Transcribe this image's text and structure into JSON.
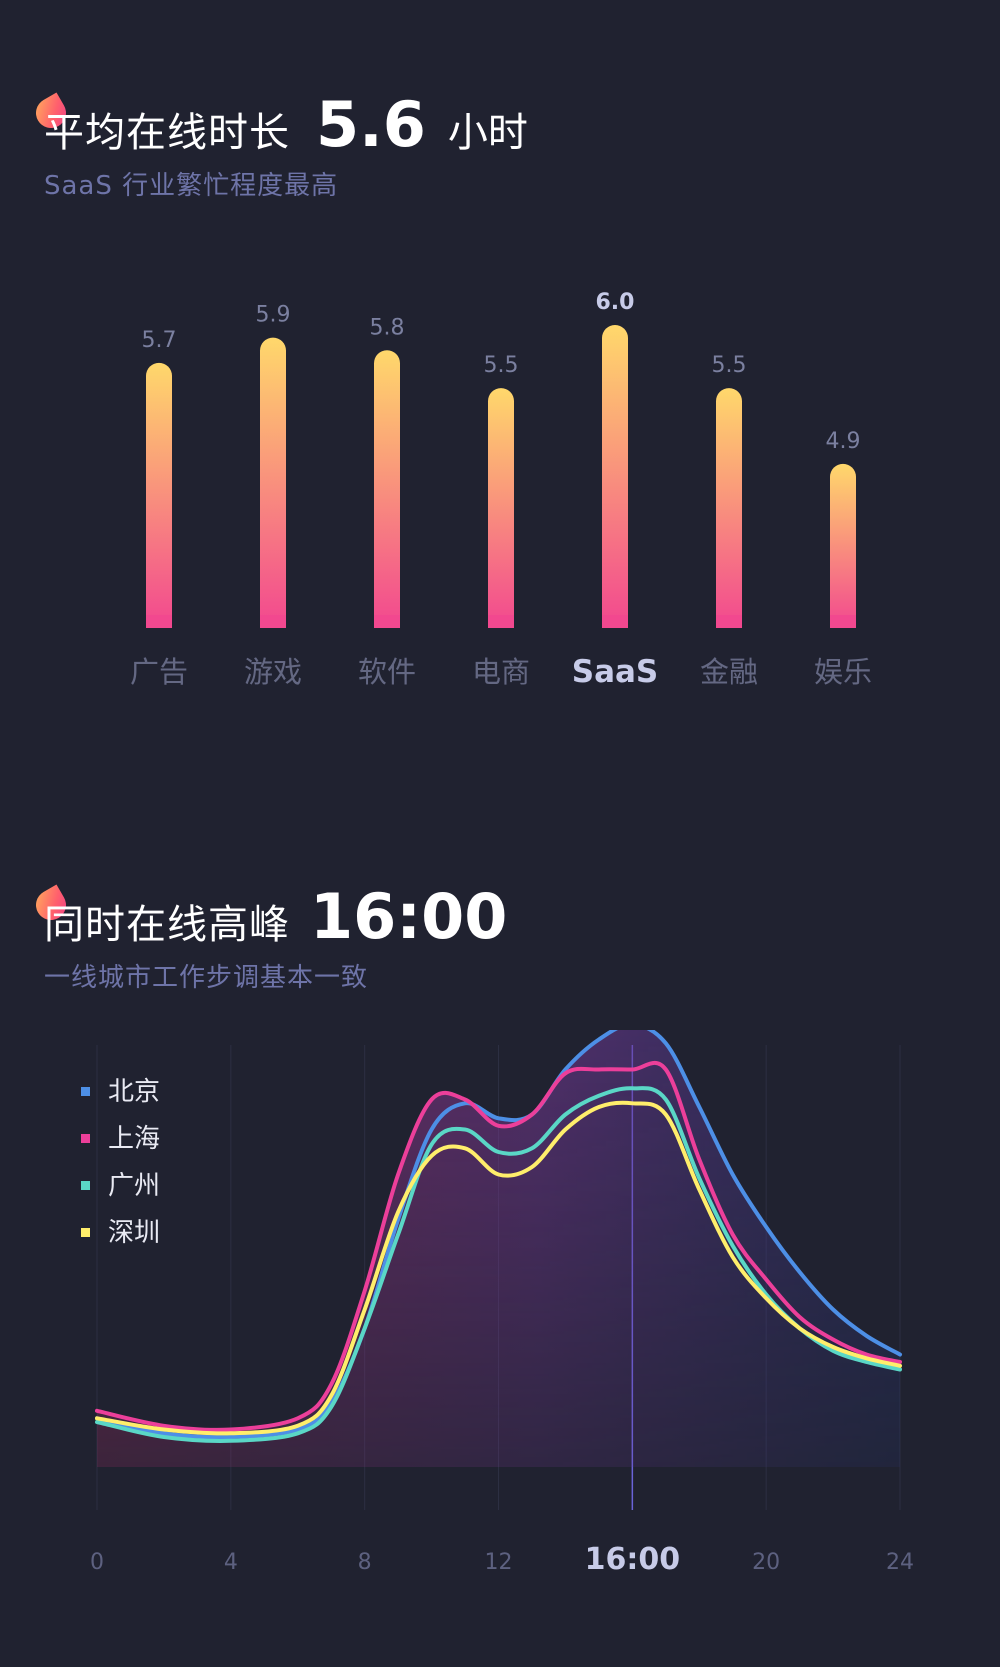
{
  "online_duration": {
    "title": "平均在线时长",
    "value": "5.6",
    "unit": "小时",
    "subtitle": "SaaS 行业繁忙程度最高"
  },
  "peak_online": {
    "title": "同时在线高峰",
    "value": "16:00",
    "subtitle": "一线城市工作步调基本一致"
  },
  "chart_data": [
    {
      "type": "bar",
      "categories": [
        "广告",
        "游戏",
        "软件",
        "电商",
        "SaaS",
        "金融",
        "娱乐"
      ],
      "values": [
        5.7,
        5.9,
        5.8,
        5.5,
        6.0,
        5.5,
        4.9
      ],
      "value_labels": [
        "5.7",
        "5.9",
        "5.8",
        "5.5",
        "6.0",
        "5.5",
        "4.9"
      ],
      "highlight": "SaaS",
      "ylim": [
        3.6,
        6.0
      ],
      "colors": {
        "top": "#ffd86b",
        "bottom": "#f2488f"
      }
    },
    {
      "type": "line",
      "x_ticks": [
        "0",
        "4",
        "8",
        "12",
        "16:00",
        "20",
        "24"
      ],
      "highlight_x": 16,
      "xlim": [
        0,
        24
      ],
      "ylim": [
        0,
        100
      ],
      "grid": true,
      "legend_position": "top-left",
      "series": [
        {
          "name": "北京",
          "color": "#4d8fe6",
          "points": [
            [
              0,
              13
            ],
            [
              2,
              9
            ],
            [
              4,
              8
            ],
            [
              6,
              10
            ],
            [
              7,
              17
            ],
            [
              8,
              37
            ],
            [
              9,
              66
            ],
            [
              10,
              90
            ],
            [
              11,
              97
            ],
            [
              12,
              93
            ],
            [
              13,
              94
            ],
            [
              14,
              106
            ],
            [
              15,
              114
            ],
            [
              16,
              118
            ],
            [
              17,
              113
            ],
            [
              18,
              96
            ],
            [
              19,
              78
            ],
            [
              20,
              64
            ],
            [
              21,
              52
            ],
            [
              22,
              42
            ],
            [
              23,
              35
            ],
            [
              24,
              30
            ]
          ]
        },
        {
          "name": "上海",
          "color": "#ec3f9a",
          "points": [
            [
              0,
              15
            ],
            [
              2,
              11
            ],
            [
              4,
              10
            ],
            [
              6,
              13
            ],
            [
              7,
              22
            ],
            [
              8,
              47
            ],
            [
              9,
              78
            ],
            [
              10,
              98
            ],
            [
              11,
              98
            ],
            [
              12,
              91
            ],
            [
              13,
              94
            ],
            [
              14,
              105
            ],
            [
              15,
              106
            ],
            [
              16,
              106
            ],
            [
              17,
              106
            ],
            [
              18,
              82
            ],
            [
              19,
              62
            ],
            [
              20,
              50
            ],
            [
              21,
              40
            ],
            [
              22,
              34
            ],
            [
              23,
              30
            ],
            [
              24,
              28
            ]
          ]
        },
        {
          "name": "广州",
          "color": "#5ad7c6",
          "points": [
            [
              0,
              12
            ],
            [
              2,
              8
            ],
            [
              4,
              7
            ],
            [
              6,
              9
            ],
            [
              7,
              16
            ],
            [
              8,
              37
            ],
            [
              9,
              62
            ],
            [
              10,
              86
            ],
            [
              11,
              90
            ],
            [
              12,
              84
            ],
            [
              13,
              85
            ],
            [
              14,
              94
            ],
            [
              15,
              99
            ],
            [
              16,
              101
            ],
            [
              17,
              98
            ],
            [
              18,
              77
            ],
            [
              19,
              59
            ],
            [
              20,
              46
            ],
            [
              21,
              37
            ],
            [
              22,
              31
            ],
            [
              23,
              28
            ],
            [
              24,
              26
            ]
          ]
        },
        {
          "name": "深圳",
          "color": "#ffee6b",
          "points": [
            [
              0,
              13
            ],
            [
              2,
              10
            ],
            [
              4,
              9
            ],
            [
              6,
              11
            ],
            [
              7,
              19
            ],
            [
              8,
              42
            ],
            [
              9,
              68
            ],
            [
              10,
              83
            ],
            [
              11,
              85
            ],
            [
              12,
              78
            ],
            [
              13,
              80
            ],
            [
              14,
              90
            ],
            [
              15,
              96
            ],
            [
              16,
              97
            ],
            [
              17,
              94
            ],
            [
              18,
              74
            ],
            [
              19,
              56
            ],
            [
              20,
              45
            ],
            [
              21,
              37
            ],
            [
              22,
              32
            ],
            [
              23,
              29
            ],
            [
              24,
              27
            ]
          ]
        }
      ]
    }
  ]
}
